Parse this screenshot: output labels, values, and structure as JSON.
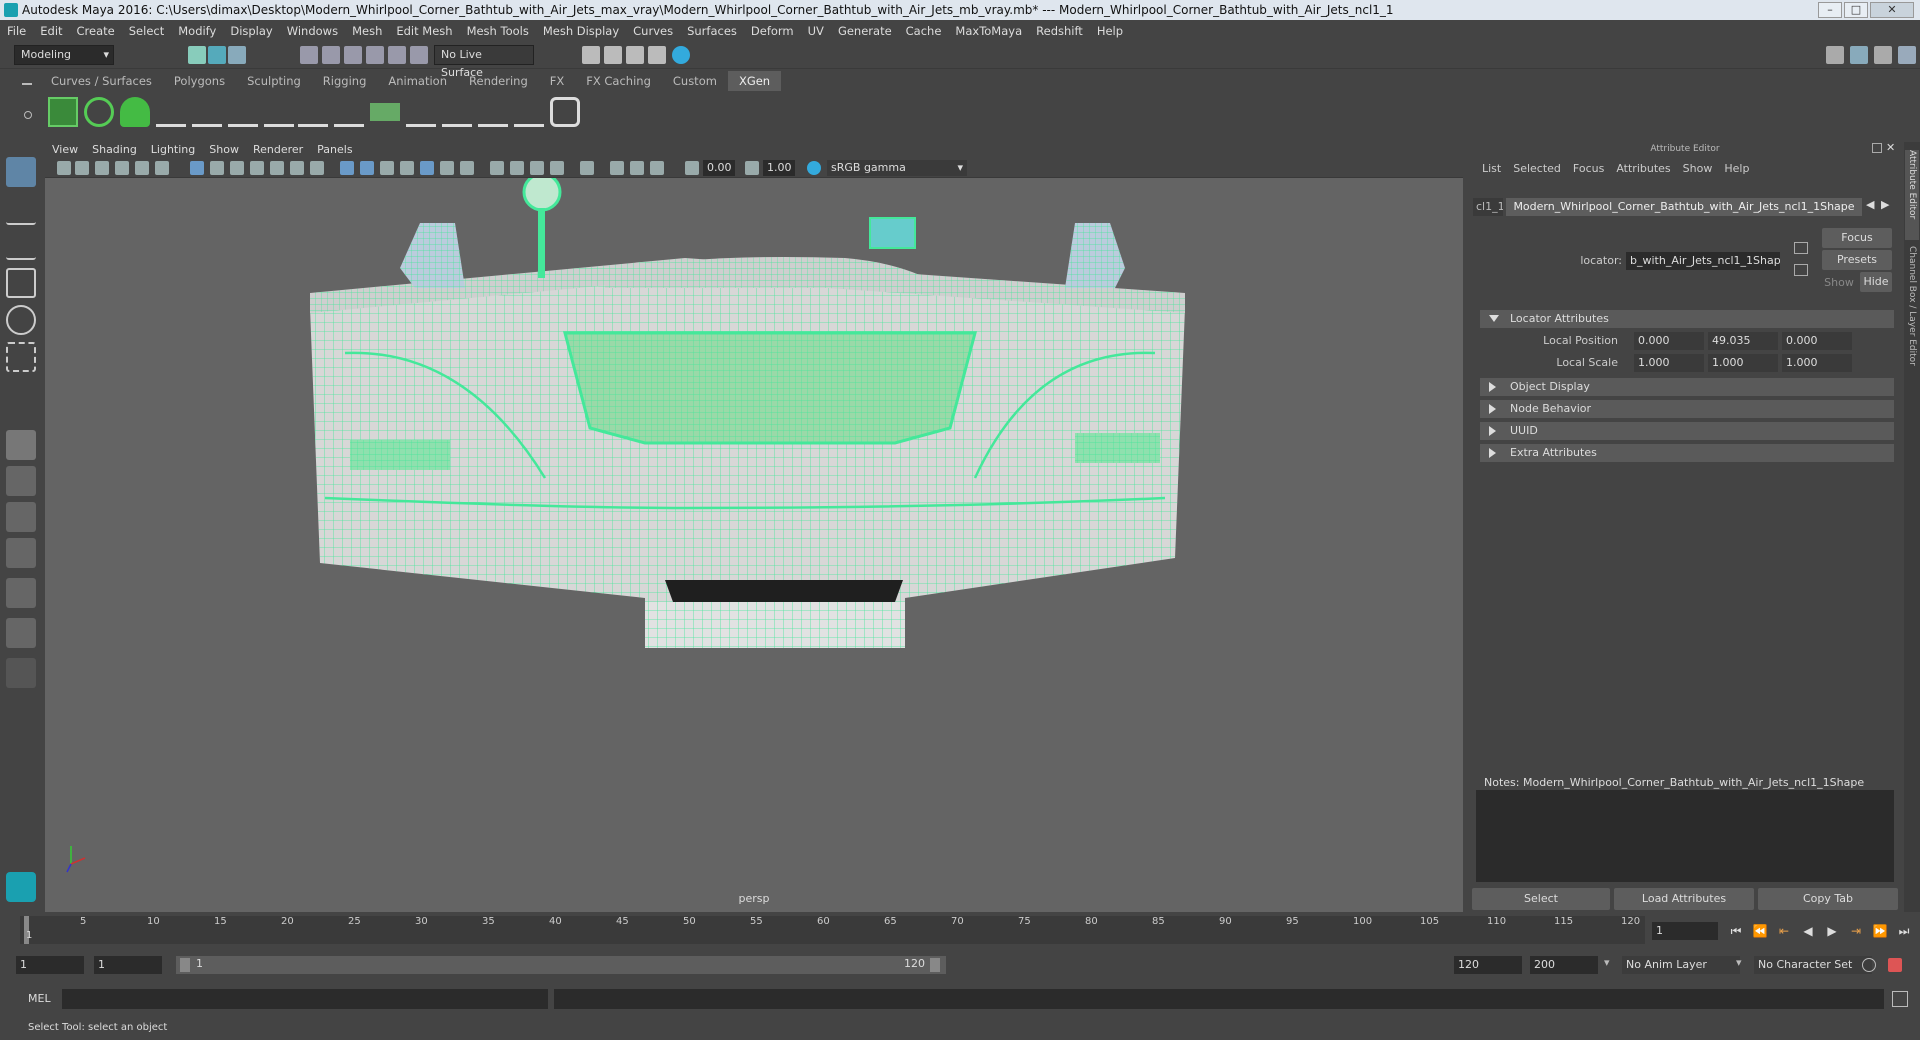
{
  "window": {
    "title": "Autodesk Maya 2016: C:\\Users\\dimax\\Desktop\\Modern_Whirlpool_Corner_Bathtub_with_Air_Jets_max_vray\\Modern_Whirlpool_Corner_Bathtub_with_Air_Jets_mb_vray.mb*   ---   Modern_Whirlpool_Corner_Bathtub_with_Air_Jets_ncl1_1"
  },
  "menu": [
    "File",
    "Edit",
    "Create",
    "Select",
    "Modify",
    "Display",
    "Windows",
    "Mesh",
    "Edit Mesh",
    "Mesh Tools",
    "Mesh Display",
    "Curves",
    "Surfaces",
    "Deform",
    "UV",
    "Generate",
    "Cache",
    "MaxToMaya",
    "Redshift",
    "Help"
  ],
  "status": {
    "mode": "Modeling",
    "live_surface": "No Live Surface"
  },
  "shelf_tabs": [
    "Curves / Surfaces",
    "Polygons",
    "Sculpting",
    "Rigging",
    "Animation",
    "Rendering",
    "FX",
    "FX Caching",
    "Custom",
    "XGen"
  ],
  "active_shelf_tab": "XGen",
  "viewport": {
    "menu": [
      "View",
      "Shading",
      "Lighting",
      "Show",
      "Renderer",
      "Panels"
    ],
    "exposure": "0.00",
    "gamma": "1.00",
    "color_space": "sRGB gamma",
    "camera_label": "persp"
  },
  "attribute_editor": {
    "header": "Attribute Editor",
    "menu": [
      "List",
      "Selected",
      "Focus",
      "Attributes",
      "Show",
      "Help"
    ],
    "tab_left": "cl1_1",
    "tab_active": "Modern_Whirlpool_Corner_Bathtub_with_Air_Jets_ncl1_1Shape",
    "locator_label": "locator:",
    "locator_value": "b_with_Air_Jets_ncl1_1Shape",
    "buttons": {
      "focus": "Focus",
      "presets": "Presets",
      "show": "Show",
      "hide": "Hide"
    },
    "sections": {
      "locator_attributes": "Locator Attributes",
      "object_display": "Object Display",
      "node_behavior": "Node Behavior",
      "uuid": "UUID",
      "extra_attributes": "Extra Attributes"
    },
    "local_position": {
      "label": "Local Position",
      "x": "0.000",
      "y": "49.035",
      "z": "0.000"
    },
    "local_scale": {
      "label": "Local Scale",
      "x": "1.000",
      "y": "1.000",
      "z": "1.000"
    },
    "notes": "Notes:  Modern_Whirlpool_Corner_Bathtub_with_Air_Jets_ncl1_1Shape",
    "bottom_buttons": {
      "select": "Select",
      "load": "Load Attributes",
      "copy": "Copy Tab"
    },
    "side_tabs": [
      "Attribute Editor",
      "Channel Box / Layer Editor"
    ]
  },
  "timeline": {
    "ticks": [
      "5",
      "10",
      "15",
      "20",
      "25",
      "30",
      "35",
      "40",
      "45",
      "50",
      "55",
      "60",
      "65",
      "70",
      "75",
      "80",
      "85",
      "90",
      "95",
      "100",
      "105",
      "110",
      "115",
      "120"
    ],
    "first": "1",
    "current_frame": "1"
  },
  "range": {
    "start": "1",
    "playback_start": "1",
    "slider_start": "1",
    "slider_end": "120",
    "playback_end": "120",
    "end": "200",
    "anim_layer": "No Anim Layer",
    "character_set": "No Character Set"
  },
  "command": {
    "lang": "MEL"
  },
  "help_line": "Select Tool: select an object",
  "colors": {
    "wire": "#44e89a",
    "viewport_bg": "#646464",
    "panel_bg": "#444444"
  }
}
